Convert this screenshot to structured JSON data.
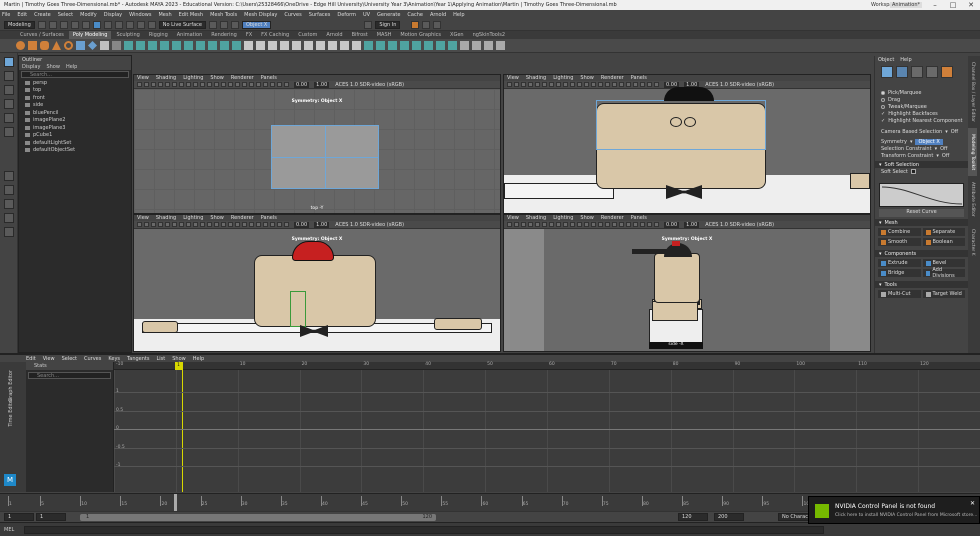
{
  "titlebar": {
    "title": "Martin | Timothy Goes Three-Dimensional.mb* - Autodesk MAYA 2023 - Educational Version: C:\\Users\\25328466\\OneDrive - Edge Hill University\\University Year 3\\Animation\\Year 1\\Applying Animation\\Martin | Timothy Goes Three-Dimensional.mb",
    "workspace_label": "Workspace:",
    "workspace": "Animation*"
  },
  "menubar": [
    "File",
    "Edit",
    "Create",
    "Select",
    "Modify",
    "Display",
    "Windows",
    "Mesh",
    "Edit Mesh",
    "Mesh Tools",
    "Mesh Display",
    "Curves",
    "Surfaces",
    "Deform",
    "UV",
    "Generate",
    "Cache",
    "Arnold",
    "Help"
  ],
  "statusline": {
    "mode": "Modeling",
    "live_surface": "No Live Surface",
    "symmetry": "Object X",
    "sign_in": "Sign In"
  },
  "shelf_tabs": [
    "Curves / Surfaces",
    "Poly Modeling",
    "Sculpting",
    "Rigging",
    "Animation",
    "Rendering",
    "FX",
    "FX Caching",
    "Custom",
    "Arnold",
    "Bifrost",
    "MASH",
    "Motion Graphics",
    "XGen",
    "ngSkinTools2"
  ],
  "shelf_active": "Poly Modeling",
  "outliner": {
    "title": "Outliner",
    "menus": [
      "Display",
      "Show",
      "Help"
    ],
    "search_placeholder": "Search...",
    "items": [
      "persp",
      "top",
      "front",
      "side",
      "bluePencil",
      "imagePlane2",
      "imagePlane3",
      "pCube1",
      "defaultLightSet",
      "defaultObjectSet"
    ]
  },
  "viewport_menus": [
    "View",
    "Shading",
    "Lighting",
    "Show",
    "Renderer",
    "Panels"
  ],
  "viewports": {
    "top_left": {
      "symmetry": "Symmetry: Object X",
      "camera": "top -Y",
      "num1": "0.00",
      "num2": "1.00",
      "aces": "ACES 1.0 SDR-video (sRGB)"
    },
    "top_right": {
      "num1": "0.00",
      "num2": "1.00",
      "aces": "ACES 1.0 SDR-video (sRGB)"
    },
    "bottom_left": {
      "symmetry": "Symmetry: Object X",
      "num1": "0.00",
      "num2": "1.00",
      "aces": "ACES 1.0 SDR-video (sRGB)"
    },
    "bottom_right": {
      "symmetry": "Symmetry: Object X",
      "camera": "side -X",
      "num1": "0.00",
      "num2": "1.00",
      "aces": "ACES 1.0 SDR-video (sRGB)"
    }
  },
  "attr": {
    "menus": [
      "Object",
      "Help"
    ],
    "options": [
      "Pick/Marquee",
      "Drag",
      "Tweak/Marquee",
      "Highlight Backfaces",
      "Highlight Nearest Component"
    ],
    "camera_selection": "Camera Based Selection",
    "camera_selection_val": "Off",
    "symmetry_label": "Symmetry",
    "symmetry_val": "Object X",
    "selection_constraint": "Selection Constraint",
    "selection_constraint_val": "Off",
    "transform_constraint": "Transform Constraint",
    "transform_constraint_val": "Off",
    "soft_selection": "Soft Selection",
    "soft_select": "Soft Select",
    "reset_curve": "Reset Curve",
    "mesh_header": "Mesh",
    "mesh_buttons": [
      "Combine",
      "Separate",
      "Smooth",
      "Boolean"
    ],
    "components_header": "Components",
    "components_buttons": [
      "Extrude",
      "Bevel",
      "Bridge",
      "Add Divisions"
    ],
    "tools_header": "Tools",
    "tools_buttons": [
      "Multi-Cut",
      "Target Weld"
    ]
  },
  "side_tabs": [
    "Channel Box / Layer Editor",
    "Modeling Toolkit",
    "Attribute Editor",
    "Character K"
  ],
  "graph": {
    "menus": [
      "Edit",
      "View",
      "Select",
      "Curves",
      "Keys",
      "Tangents",
      "List",
      "Show",
      "Help"
    ],
    "stats": "Stats",
    "search_placeholder": "Search...",
    "left_tabs": [
      "Graph Editor",
      "Time Editor"
    ],
    "ruler_ticks": [
      "-10",
      "0",
      "10",
      "20",
      "30",
      "40",
      "50",
      "60",
      "70",
      "80",
      "90",
      "100",
      "110",
      "120"
    ],
    "y_labels": [
      "1",
      "0.5",
      "0",
      "-0.5",
      "-1"
    ],
    "current_frame": "1"
  },
  "timeslider": {
    "ticks": [
      "1",
      "5",
      "10",
      "15",
      "20",
      "25",
      "30",
      "35",
      "40",
      "45",
      "50",
      "55",
      "60",
      "65",
      "70",
      "75",
      "80",
      "85",
      "90",
      "95",
      "100",
      "105",
      "110",
      "115",
      "120"
    ]
  },
  "range": {
    "start": "1",
    "inner_start": "1",
    "inner_end": "120",
    "end": "120",
    "end2": "200",
    "character": "No Character"
  },
  "cmd": {
    "label": "MEL"
  },
  "toast": {
    "title": "NVIDIA Control Panel is not found",
    "body": "Click here to install NVIDIA Control Panel from Microsoft store..."
  },
  "colors": {
    "accent": "#6fa7d8",
    "playhead": "#d8d800",
    "toast_logo": "#76b900",
    "skin": "#d9c7a8"
  }
}
